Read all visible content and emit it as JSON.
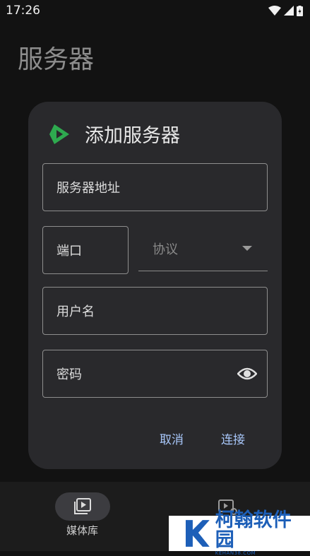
{
  "status_bar": {
    "time": "17:26"
  },
  "page": {
    "title": "服务器"
  },
  "dialog": {
    "title": "添加服务器",
    "fields": {
      "server_address": "服务器地址",
      "port": "端口",
      "protocol": "协议",
      "username": "用户名",
      "password": "密码"
    },
    "buttons": {
      "cancel": "取消",
      "connect": "连接"
    }
  },
  "bottom_nav": {
    "items": [
      {
        "label": "媒体库",
        "icon": "video-library-icon",
        "selected": true
      },
      {
        "label": "",
        "icon": "video-settings-icon",
        "selected": false
      }
    ]
  },
  "watermark": {
    "text": "柯翰软件园",
    "sub": "KEHAN38.COM"
  },
  "colors": {
    "accent": "#a8c7fa",
    "logo_green": "#2eaa4f",
    "dialog_bg": "#29292c"
  }
}
